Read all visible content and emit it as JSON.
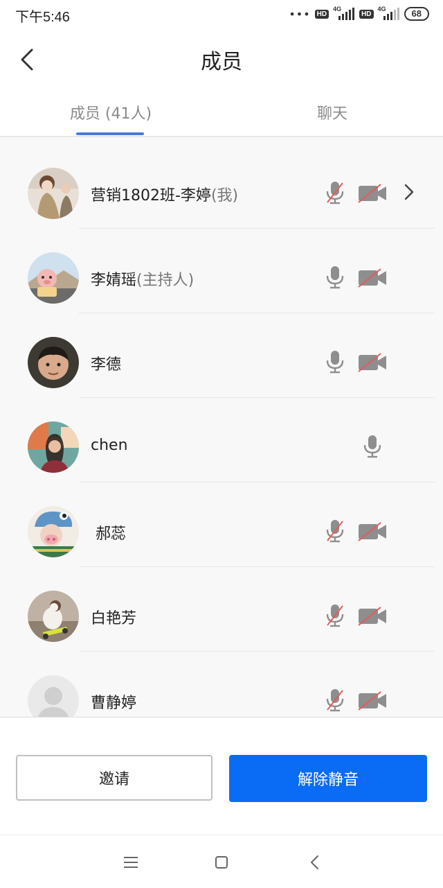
{
  "status_bar": {
    "time": "下午5:46",
    "dots": "•••",
    "hd": "HD",
    "net": "4G",
    "battery": "68"
  },
  "header": {
    "title": "成员"
  },
  "tabs": [
    {
      "label": "成员 (41人)"
    },
    {
      "label": "聊天"
    }
  ],
  "members": [
    {
      "name": "营销1802班-李婷",
      "suffix": "(我)",
      "mic": "muted",
      "camera": "off",
      "chevron": true
    },
    {
      "name": "李婧瑶",
      "suffix": "(主持人)",
      "mic": "on",
      "camera": "off"
    },
    {
      "name": "李德",
      "suffix": "",
      "mic": "on",
      "camera": "off"
    },
    {
      "name": "chen",
      "suffix": "",
      "mic": "on",
      "camera": "none"
    },
    {
      "name": " 郝蕊",
      "suffix": "",
      "mic": "muted",
      "camera": "off"
    },
    {
      "name": "白艳芳",
      "suffix": "",
      "mic": "muted",
      "camera": "off"
    },
    {
      "name": "曹静婷",
      "suffix": "",
      "mic": "muted",
      "camera": "off"
    }
  ],
  "buttons": {
    "invite": "邀请",
    "unmute_all": "解除静音"
  },
  "colors": {
    "primary": "#0a6cf5",
    "tab_indicator": "#4a78e0",
    "muted_slash": "#e45b5b",
    "icon_gray": "#8e8e8e"
  }
}
